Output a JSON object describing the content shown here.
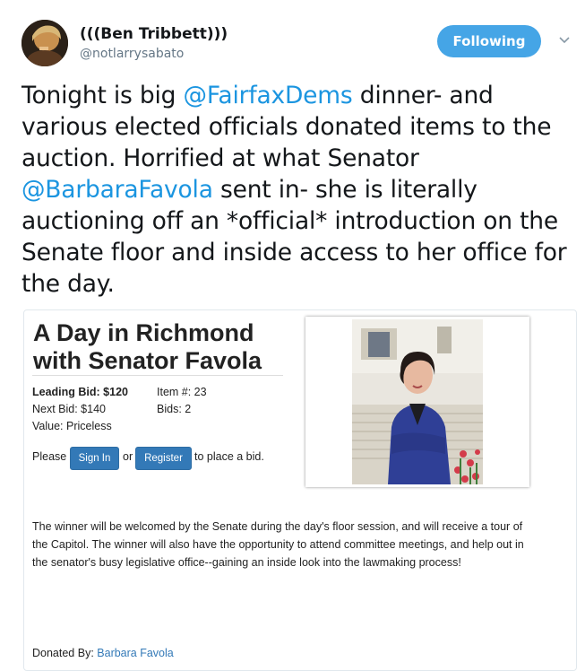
{
  "author": {
    "display_name": "(((Ben Tribbett)))",
    "handle": "@notlarrysabato"
  },
  "follow_button": {
    "label": "Following"
  },
  "tweet": {
    "segments": [
      {
        "text": "Tonight is big ",
        "mention": false
      },
      {
        "text": "@FairfaxDems",
        "mention": true
      },
      {
        "text": " dinner- and various elected officials donated items to the auction.  Horrified at what Senator ",
        "mention": false
      },
      {
        "text": "@BarbaraFavola",
        "mention": true
      },
      {
        "text": " sent in- she is literally auctioning off an *official* introduction on the Senate floor and inside access to her office for the day.",
        "mention": false
      }
    ]
  },
  "auction": {
    "title_line1": "A Day in Richmond",
    "title_line2": "with Senator Favola",
    "leading_bid": "Leading Bid: $120",
    "next_bid": "Next Bid: $140",
    "value": "Value: Priceless",
    "item_number": "Item #: 23",
    "bids": "Bids: 2",
    "please": "Please",
    "sign_in": "Sign In",
    "or": "or",
    "register": "Register",
    "to_place": "to place a bid.",
    "description": "The winner will be welcomed by the Senate during the day's floor session, and will receive a tour of the Capitol. The winner will also have the opportunity to attend committee meetings, and help out in the senator's busy legislative office--gaining an inside look into the lawmaking process!",
    "donated_by_label": "Donated By:",
    "donated_by_name": "Barbara Favola"
  },
  "colors": {
    "accent": "#1b95e0",
    "follow_button": "#45a5e6",
    "link_blue": "#3379b7"
  },
  "icons": [
    "chevron-down-icon"
  ]
}
